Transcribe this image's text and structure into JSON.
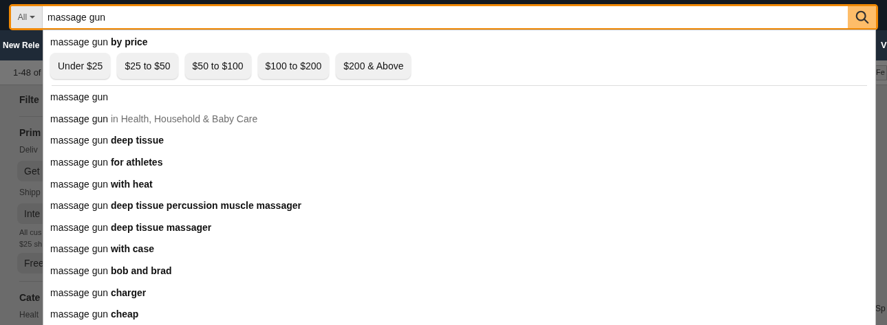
{
  "search": {
    "category": "All",
    "value": "massage gun"
  },
  "nav": {
    "left_item": "New Rele",
    "right_item": "V"
  },
  "results_bar": {
    "count": "1-48 of",
    "sort": "Fe"
  },
  "sidebar": {
    "items": [
      {
        "kind": "heading",
        "text": "Filte"
      },
      {
        "kind": "divider"
      },
      {
        "kind": "section",
        "text": "Prim"
      },
      {
        "kind": "label",
        "text": "Deliv"
      },
      {
        "kind": "chip",
        "text": "Get"
      },
      {
        "kind": "label",
        "text": "Shipp"
      },
      {
        "kind": "chip",
        "text": "Inte"
      },
      {
        "kind": "note",
        "text": "All cus"
      },
      {
        "kind": "note",
        "text": "$25 sh"
      },
      {
        "kind": "chip",
        "text": "Free"
      },
      {
        "kind": "divider"
      },
      {
        "kind": "section",
        "text": "Cate"
      },
      {
        "kind": "label",
        "text": "Healt"
      }
    ]
  },
  "right_edge": {
    "text": "Sp"
  },
  "dropdown": {
    "price_heading": "massage gun **by price**",
    "price_buttons": [
      "Under $25",
      "$25 to $50",
      "$50 to $100",
      "$100 to $200",
      "$200 & Above"
    ],
    "suggestions": [
      {
        "kind": "plain",
        "text": "massage gun"
      },
      {
        "kind": "department",
        "text": "massage gun",
        "suffix": "in Health, Household & Baby Care"
      },
      {
        "kind": "refinement",
        "text": "massage gun",
        "suffix": "deep tissue"
      },
      {
        "kind": "refinement",
        "text": "massage gun",
        "suffix": "for athletes"
      },
      {
        "kind": "refinement",
        "text": "massage gun",
        "suffix": "with heat"
      },
      {
        "kind": "refinement",
        "text": "massage gun",
        "suffix": "deep tissue percussion muscle massager"
      },
      {
        "kind": "refinement",
        "text": "massage gun",
        "suffix": "deep tissue massager"
      },
      {
        "kind": "refinement",
        "text": "massage gun",
        "suffix": "with case"
      },
      {
        "kind": "refinement",
        "text": "massage gun",
        "suffix": "bob and brad"
      },
      {
        "kind": "refinement",
        "text": "massage gun",
        "suffix": "charger"
      },
      {
        "kind": "refinement",
        "text": "massage gun",
        "suffix": "cheap"
      }
    ]
  }
}
